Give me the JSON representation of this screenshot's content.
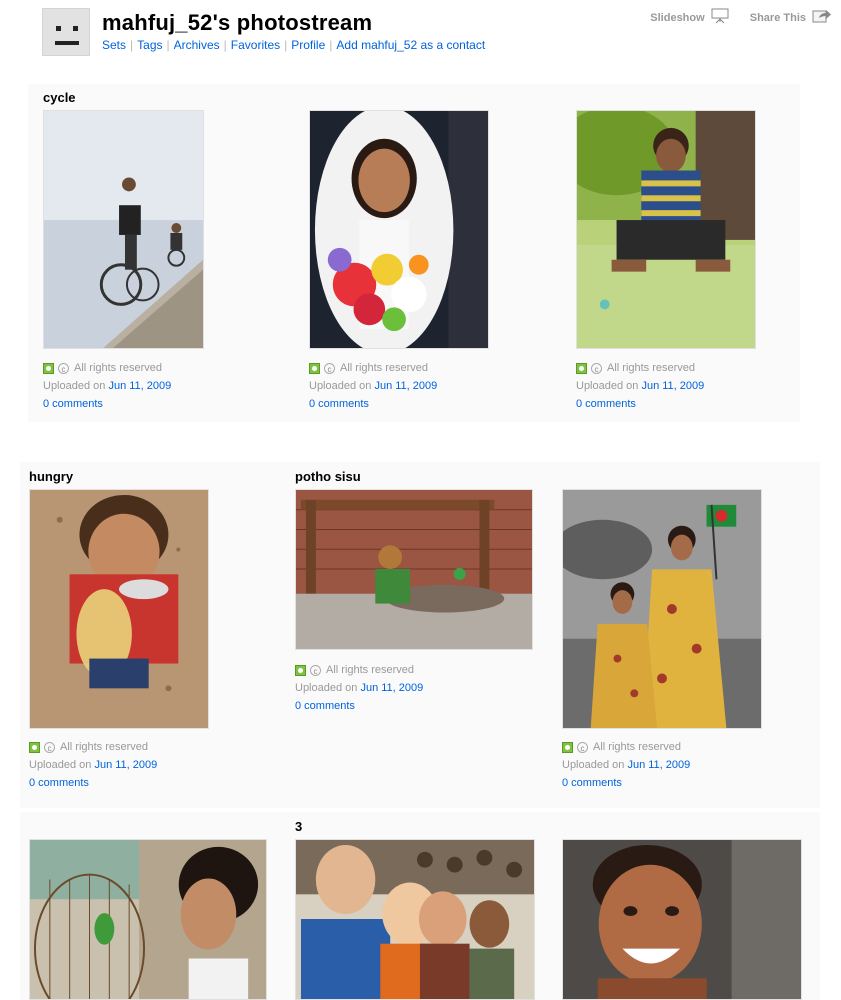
{
  "header": {
    "title": "mahfuj_52's photostream",
    "nav": [
      "Sets",
      "Tags",
      "Archives",
      "Favorites",
      "Profile",
      "Add mahfuj_52 as a contact"
    ]
  },
  "tools": {
    "slideshow": "Slideshow",
    "share": "Share This"
  },
  "icons": {
    "buddy": "buddy-icon",
    "slideshow": "slideshow-icon",
    "share": "share-icon",
    "license": "license-icon",
    "copyright": "copyright-icon"
  },
  "colors": {
    "link": "#0063dc",
    "license_green": "#7fc241",
    "panel": "#fafafa"
  },
  "photos": [
    {
      "set_title": "cycle",
      "license": "All rights reserved",
      "uploaded_prefix": "Uploaded on",
      "uploaded_date": "Jun 11, 2009",
      "comments": "0 comments",
      "depicts": "boys-on-bicycles"
    },
    {
      "set_title": "",
      "license": "All rights reserved",
      "uploaded_prefix": "Uploaded on",
      "uploaded_date": "Jun 11, 2009",
      "comments": "0 comments",
      "depicts": "girl-with-flowers"
    },
    {
      "set_title": "",
      "license": "All rights reserved",
      "uploaded_prefix": "Uploaded on",
      "uploaded_date": "Jun 11, 2009",
      "comments": "0 comments",
      "depicts": "boy-playing-marbles"
    },
    {
      "set_title": "hungry",
      "license": "All rights reserved",
      "uploaded_prefix": "Uploaded on",
      "uploaded_date": "Jun 11, 2009",
      "comments": "0 comments",
      "depicts": "child-eating"
    },
    {
      "set_title": "potho sisu",
      "license": "All rights reserved",
      "uploaded_prefix": "Uploaded on",
      "uploaded_date": "Jun 11, 2009",
      "comments": "0 comments",
      "depicts": "street-baby"
    },
    {
      "set_title": "",
      "license": "All rights reserved",
      "uploaded_prefix": "Uploaded on",
      "uploaded_date": "Jun 11, 2009",
      "comments": "0 comments",
      "depicts": "girls-with-flag"
    },
    {
      "set_title": "",
      "depicts": "girl-with-parrot-cage"
    },
    {
      "set_title": "3",
      "depicts": "group-of-students"
    },
    {
      "set_title": "",
      "depicts": "smiling-boy"
    }
  ]
}
